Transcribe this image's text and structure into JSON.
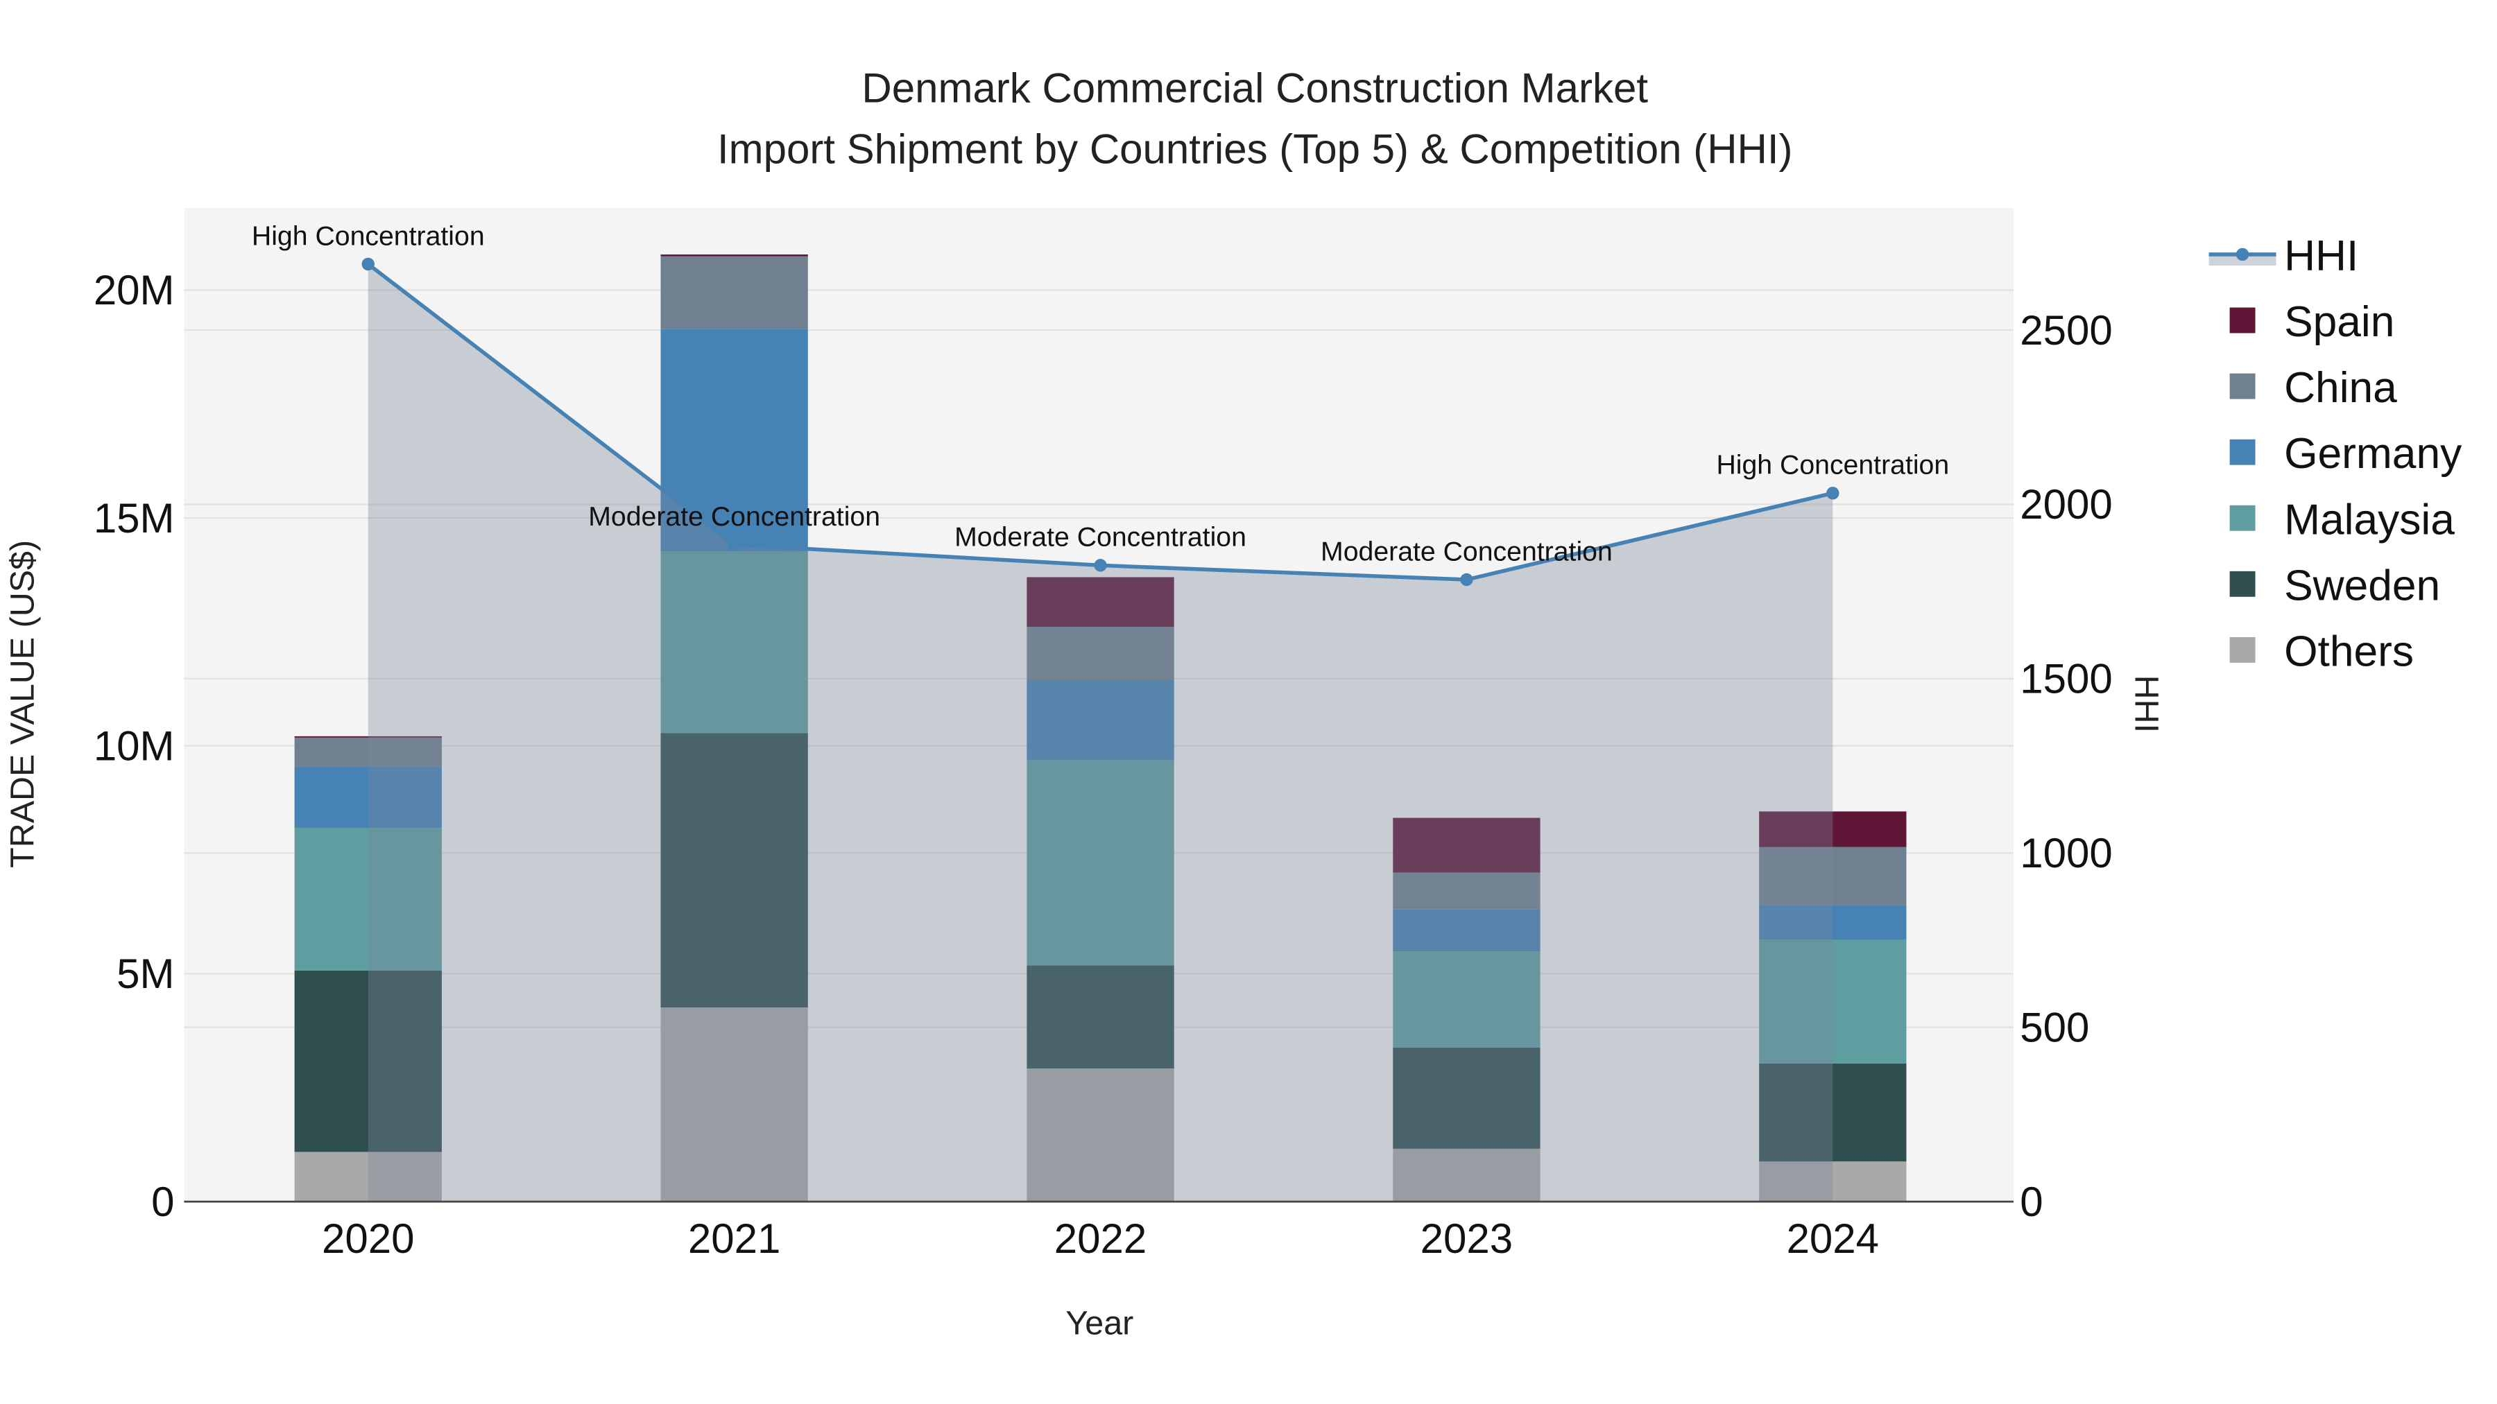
{
  "chart_data": {
    "type": "bar",
    "title": "Denmark Commercial Construction Market",
    "subtitle": "Import Shipment by Countries (Top 5) & Competition (HHI)",
    "xlabel": "Year",
    "ylabel": "TRADE VALUE (US$)",
    "y2label": "HHI",
    "categories": [
      "2020",
      "2021",
      "2022",
      "2023",
      "2024"
    ],
    "stacked": true,
    "ylim": [
      0,
      21800000
    ],
    "y2lim": [
      0,
      2850
    ],
    "yticks": [
      0,
      5000000,
      10000000,
      15000000,
      20000000
    ],
    "ytick_labels": [
      "0",
      "5M",
      "10M",
      "15M",
      "20M"
    ],
    "y2ticks": [
      0,
      500,
      1000,
      1500,
      2000,
      2500
    ],
    "y2tick_labels": [
      "0",
      "500",
      "1000",
      "1500",
      "2000",
      "2500"
    ],
    "series": [
      {
        "name": "Others",
        "color": "#a9a9a9",
        "values": [
          1090000,
          4260000,
          2920000,
          1160000,
          880000
        ]
      },
      {
        "name": "Sweden",
        "color": "#2f4f4f",
        "values": [
          3980000,
          6020000,
          2260000,
          2220000,
          2150000
        ]
      },
      {
        "name": "Malaysia",
        "color": "#5f9ea0",
        "values": [
          3130000,
          3980000,
          4500000,
          2110000,
          2710000
        ]
      },
      {
        "name": "Germany",
        "color": "#4682b4",
        "values": [
          1340000,
          4890000,
          1760000,
          920000,
          770000
        ]
      },
      {
        "name": "China",
        "color": "#708090",
        "values": [
          640000,
          1590000,
          1170000,
          810000,
          1270000
        ]
      },
      {
        "name": "Spain",
        "color": "#5f1536",
        "values": [
          30000,
          40000,
          1090000,
          1200000,
          780000
        ]
      }
    ],
    "hhi": {
      "name": "HHI",
      "color": "#4682b4",
      "values": [
        2689,
        1884,
        1825,
        1784,
        2032
      ],
      "annotations": [
        "High Concentration",
        "Moderate Concentration",
        "Moderate Concentration",
        "Moderate Concentration",
        "High Concentration"
      ]
    },
    "legend_order": [
      "HHI",
      "Spain",
      "China",
      "Germany",
      "Malaysia",
      "Sweden",
      "Others"
    ],
    "legend_position": "right",
    "grid": true
  }
}
